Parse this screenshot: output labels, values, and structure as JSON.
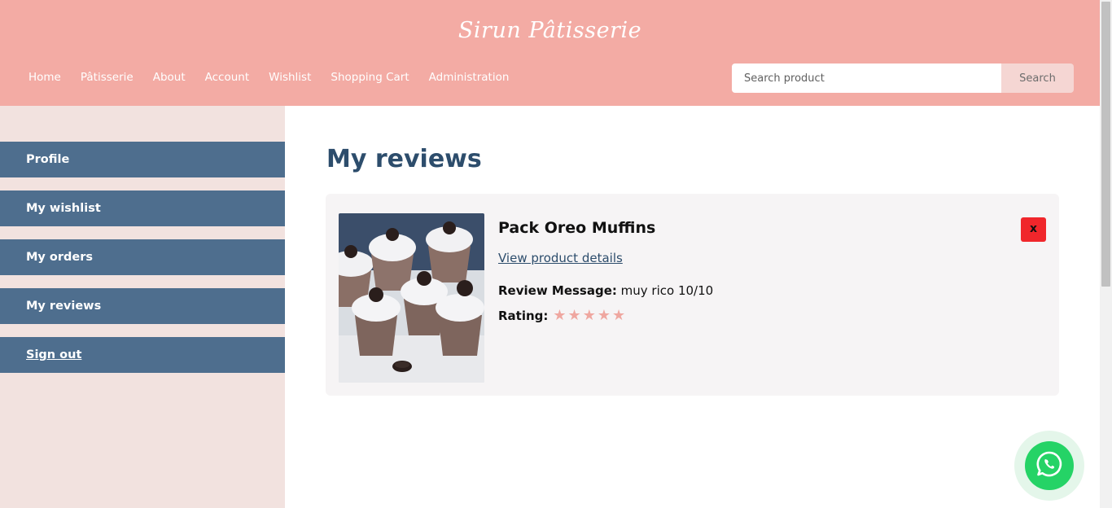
{
  "header": {
    "brand": "Sirun Pâtisserie",
    "nav": [
      "Home",
      "Pâtisserie",
      "About",
      "Account",
      "Wishlist",
      "Shopping Cart",
      "Administration"
    ],
    "search": {
      "placeholder": "Search product",
      "value": "",
      "button_label": "Search"
    }
  },
  "sidebar": {
    "items": [
      {
        "label": "Profile"
      },
      {
        "label": "My wishlist"
      },
      {
        "label": "My orders"
      },
      {
        "label": "My reviews"
      },
      {
        "label": "Sign out"
      }
    ]
  },
  "main": {
    "title": "My reviews",
    "reviews": [
      {
        "product_name": "Pack Oreo Muffins",
        "details_link": "View product details",
        "message_label": "Review Message:",
        "message": "muy rico 10/10",
        "rating_label": "Rating:",
        "rating": 5,
        "rating_max": 5,
        "delete_label": "x"
      }
    ]
  },
  "colors": {
    "header": "#f3aba4",
    "sidebar_bg": "#f2e2df",
    "sidebar_item": "#4e6e8e",
    "title": "#2d4d6c",
    "star": "#efa7a0",
    "delete": "#f0262b",
    "whatsapp": "#25d366"
  },
  "icons": {
    "whatsapp": "whatsapp-icon",
    "star": "star-icon"
  }
}
